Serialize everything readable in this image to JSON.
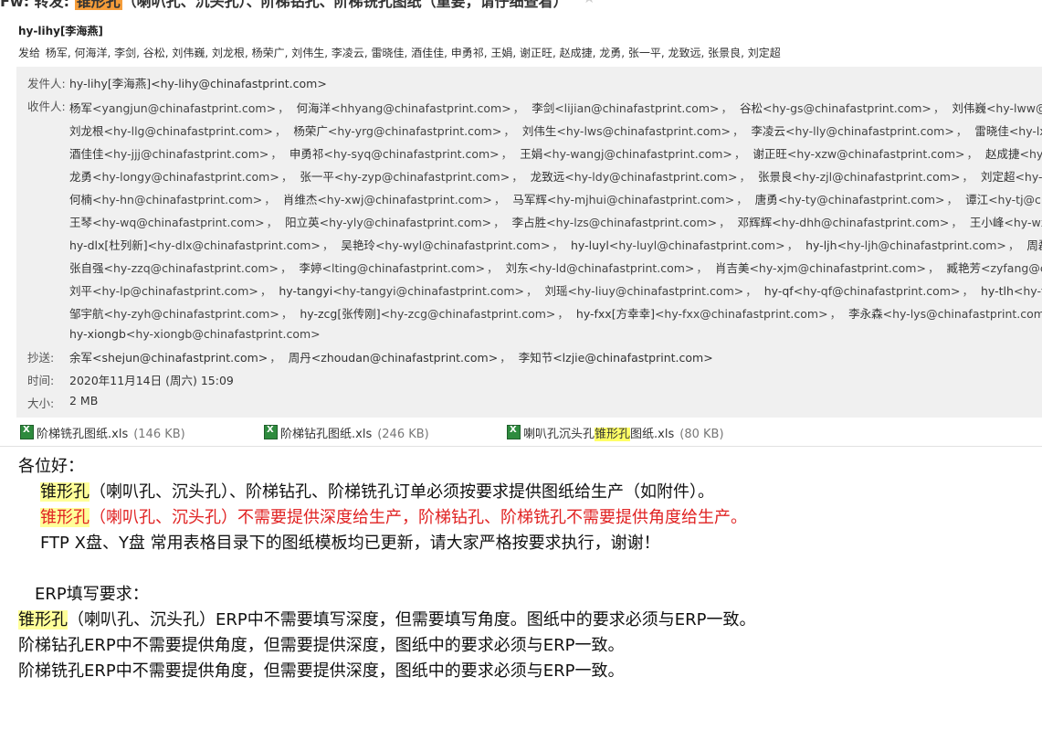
{
  "subject": {
    "prefix": "Fw: 转发: ",
    "highlight": "锥形孔",
    "rest": "（喇叭孔、沉头孔）、阶梯钻孔、阶梯铣孔图纸（重要，请仔细查看）",
    "star_icon": "star-icon"
  },
  "from_line": "hy-lihy[李海燕]",
  "send_to_line": {
    "label": "发给",
    "names": "杨军, 何海洋, 李剑, 谷松, 刘伟巍, 刘龙根, 杨荣广, 刘伟生, 李凌云, 雷晓佳, 酒佳佳, 申勇祁, 王娟, 谢正旺, 赵成捷, 龙勇, 张一平, 龙致远, 张景良, 刘定超"
  },
  "details": {
    "sender_label": "发件人:",
    "sender": "hy-lihy[李海燕]<hy-lihy@chinafastprint.com>",
    "recipients_label": "收件人:",
    "recipient_lines": [
      [
        [
          "杨军",
          "<yangjun@chinafastprint.com>"
        ],
        [
          "何海洋",
          "<hhyang@chinafastprint.com>"
        ],
        [
          "李剑",
          "<lijian@chinafastprint.com>"
        ],
        [
          "谷松",
          "<hy-gs@chinafastprint.com>"
        ],
        [
          "刘伟巍",
          "<hy-lww@chinafastprint.com>"
        ]
      ],
      [
        [
          "刘龙根",
          "<hy-llg@chinafastprint.com>"
        ],
        [
          "杨荣广",
          "<hy-yrg@chinafastprint.com>"
        ],
        [
          "刘伟生",
          "<hy-lws@chinafastprint.com>"
        ],
        [
          "李凌云",
          "<hy-lly@chinafastprint.com>"
        ],
        [
          "雷晓佳",
          "<hy-lxj@chinafastprint.com>"
        ]
      ],
      [
        [
          "酒佳佳",
          "<hy-jjj@chinafastprint.com>"
        ],
        [
          "申勇祁",
          "<hy-syq@chinafastprint.com>"
        ],
        [
          "王娟",
          "<hy-wangj@chinafastprint.com>"
        ],
        [
          "谢正旺",
          "<hy-xzw@chinafastprint.com>"
        ],
        [
          "赵成捷",
          "<hy-zcj@chinafastprint.com>"
        ]
      ],
      [
        [
          "龙勇",
          "<hy-longy@chinafastprint.com>"
        ],
        [
          "张一平",
          "<hy-zyp@chinafastprint.com>"
        ],
        [
          "龙致远",
          "<hy-ldy@chinafastprint.com>"
        ],
        [
          "张景良",
          "<hy-zjl@chinafastprint.com>"
        ],
        [
          "刘定超",
          "<hy-ldc@chinafastprint.com>"
        ]
      ],
      [
        [
          "何楠",
          "<hy-hn@chinafastprint.com>"
        ],
        [
          "肖维杰",
          "<hy-xwj@chinafastprint.com>"
        ],
        [
          "马军辉",
          "<hy-mjhui@chinafastprint.com>"
        ],
        [
          "唐勇",
          "<hy-ty@chinafastprint.com>"
        ],
        [
          "谭江",
          "<hy-tj@chinafastprint.com>"
        ]
      ],
      [
        [
          "王琴",
          "<hy-wq@chinafastprint.com>"
        ],
        [
          "阳立英",
          "<hy-yly@chinafastprint.com>"
        ],
        [
          "李占胜",
          "<hy-lzs@chinafastprint.com>"
        ],
        [
          "邓辉辉",
          "<hy-dhh@chinafastprint.com>"
        ],
        [
          "王小峰",
          "<hy-wxf@chinafastprint.com>"
        ]
      ],
      [
        [
          "hy-dlx[杜列新]",
          "<hy-dlx@chinafastprint.com>"
        ],
        [
          "吴艳玲",
          "<hy-wyl@chinafastprint.com>"
        ],
        [
          "hy-luyl",
          "<hy-luyl@chinafastprint.com>"
        ],
        [
          "hy-ljh",
          "<hy-ljh@chinafastprint.com>"
        ],
        [
          "周磊",
          "<hy-zl@chinafastprint.com>"
        ]
      ],
      [
        [
          "张自强",
          "<hy-zzq@chinafastprint.com>"
        ],
        [
          "李婷",
          "<lting@chinafastprint.com>"
        ],
        [
          "刘东",
          "<hy-ld@chinafastprint.com>"
        ],
        [
          "肖吉美",
          "<hy-xjm@chinafastprint.com>"
        ],
        [
          "臧艳芳",
          "<zyfang@chinafastprint.com>"
        ]
      ],
      [
        [
          "刘平",
          "<hy-lp@chinafastprint.com>"
        ],
        [
          "hy-tangyi",
          "<hy-tangyi@chinafastprint.com>"
        ],
        [
          "刘瑶",
          "<hy-liuy@chinafastprint.com>"
        ],
        [
          "hy-qf",
          "<hy-qf@chinafastprint.com>"
        ],
        [
          "hy-tlh",
          "<hy-tlh@chinafastprint.com>"
        ]
      ],
      [
        [
          "邹宇航",
          "<hy-zyh@chinafastprint.com>"
        ],
        [
          "hy-zcg[张传刚]",
          "<hy-zcg@chinafastprint.com>"
        ],
        [
          "hy-fxx[方幸幸]",
          "<hy-fxx@chinafastprint.com>"
        ],
        [
          "李永森",
          "<hy-lys@chinafastprint.com>"
        ],
        [
          "hy",
          ""
        ]
      ],
      [
        [
          "hy-xiongb",
          "<hy-xiongb@chinafastprint.com>"
        ]
      ]
    ],
    "cc_label": "抄送:",
    "cc": [
      [
        "余军",
        "<shejun@chinafastprint.com>"
      ],
      [
        "周丹",
        "<zhoudan@chinafastprint.com>"
      ],
      [
        "李知节",
        "<lzjie@chinafastprint.com>"
      ]
    ],
    "time_label": "时间:",
    "time": "2020年11月14日 (周六) 15:09",
    "size_label": "大小:",
    "size": "2 MB"
  },
  "attachments": [
    {
      "name": "阶梯铣孔图纸.xls",
      "size": "(146 KB)"
    },
    {
      "name": "阶梯钻孔图纸.xls",
      "size": "(246 KB)"
    },
    {
      "name_pre": "喇叭孔沉头孔",
      "name_hl": "锥形孔",
      "name_post": "图纸.xls",
      "size": "(80 KB)"
    }
  ],
  "body": {
    "greeting": "各位好：",
    "line1_hl": "锥形孔",
    "line1_rest": "（喇叭孔、沉头孔）、阶梯钻孔、阶梯铣孔订单必须按要求提供图纸给生产（如附件）。",
    "line2_hl": "锥形孔",
    "line2_rest": "（喇叭孔、沉头孔）不需要提供深度给生产，阶梯钻孔、阶梯铣孔不需要提供角度给生产。",
    "line3": "FTP X盘、Y盘 常用表格目录下的图纸模板均已更新，请大家严格按要求执行，谢谢！",
    "erp_heading": "ERP填写要求：",
    "erp1_hl": "锥形孔",
    "erp1_rest": "（喇叭孔、沉头孔）ERP中不需要填写深度，但需要填写角度。图纸中的要求必须与ERP一致。",
    "erp2": "阶梯钻孔ERP中不需要提供角度，但需要提供深度，图纸中的要求必须与ERP一致。",
    "erp3": "阶梯铣孔ERP中不需要提供角度，但需要提供深度，图纸中的要求必须与ERP一致。"
  },
  "colors": {
    "highlight_subject": "#f59d3a",
    "highlight_body": "#ffff99",
    "red_text": "#e02222",
    "details_bg": "#f0f0f0"
  }
}
